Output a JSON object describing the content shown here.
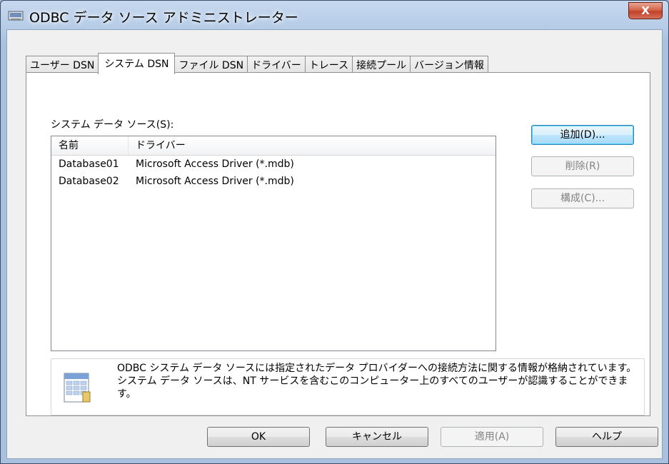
{
  "window": {
    "title": "ODBC データ ソース アドミニストレーター",
    "close_label": "X"
  },
  "tabs": [
    {
      "label": "ユーザー DSN"
    },
    {
      "label": "システム DSN"
    },
    {
      "label": "ファイル DSN"
    },
    {
      "label": "ドライバー"
    },
    {
      "label": "トレース"
    },
    {
      "label": "接続プール"
    },
    {
      "label": "バージョン情報"
    }
  ],
  "panel": {
    "section_label": "システム データ ソース(S):",
    "columns": {
      "name": "名前",
      "driver": "ドライバー"
    },
    "rows": [
      {
        "name": "Database01",
        "driver": "Microsoft Access Driver (*.mdb)"
      },
      {
        "name": "Database02",
        "driver": "Microsoft Access Driver (*.mdb)"
      }
    ],
    "buttons": {
      "add": "追加(D)...",
      "remove": "削除(R)",
      "configure": "構成(C)..."
    },
    "info_text": "ODBC システム データ ソースには指定されたデータ プロバイダーへの接続方法に関する情報が格納されています。システム データ ソースは、NT サービスを含むこのコンピューター上のすべてのユーザーが認識することができます。"
  },
  "footer": {
    "ok": "OK",
    "cancel": "キャンセル",
    "apply": "適用(A)",
    "help": "ヘルプ"
  }
}
